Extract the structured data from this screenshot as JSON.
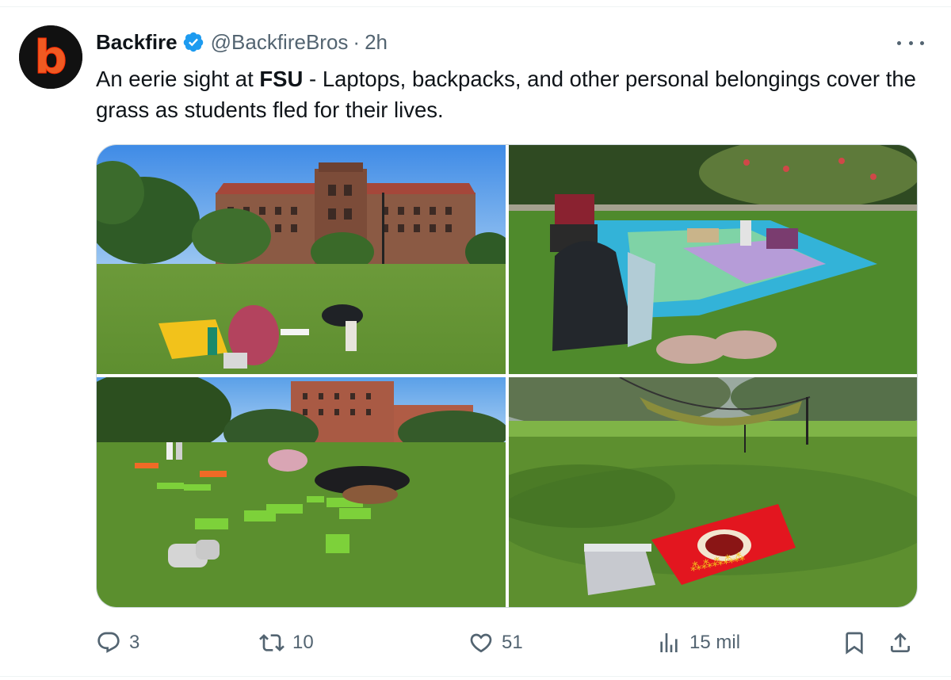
{
  "author": {
    "name": "Backfire",
    "handle": "@BackfireBros",
    "separator": "·",
    "time": "2h",
    "avatar_letter": "b",
    "verified": true
  },
  "tweet": {
    "text_before": "An eerie sight at ",
    "text_bold": "FSU",
    "text_after": " - Laptops, backpacks, and other personal belongings cover the grass as students fled for their lives."
  },
  "media": {
    "photos": [
      {
        "id": "campus-building-lawn"
      },
      {
        "id": "blanket-backpack-shoes"
      },
      {
        "id": "lawn-game-blocks"
      },
      {
        "id": "hammock-towel-backpack"
      }
    ]
  },
  "actions": {
    "reply_count": "3",
    "retweet_count": "10",
    "like_count": "51",
    "views_count": "15 mil"
  },
  "icons": {
    "reply": "reply-icon",
    "retweet": "retweet-icon",
    "like": "heart-icon",
    "views": "views-icon",
    "bookmark": "bookmark-icon",
    "share": "share-icon",
    "more": "more-icon",
    "verified": "verified-badge-icon"
  },
  "colors": {
    "verified_blue": "#1d9bf0",
    "muted_text": "#536471",
    "text": "#0f1419",
    "avatar_orange": "#f05a22"
  }
}
